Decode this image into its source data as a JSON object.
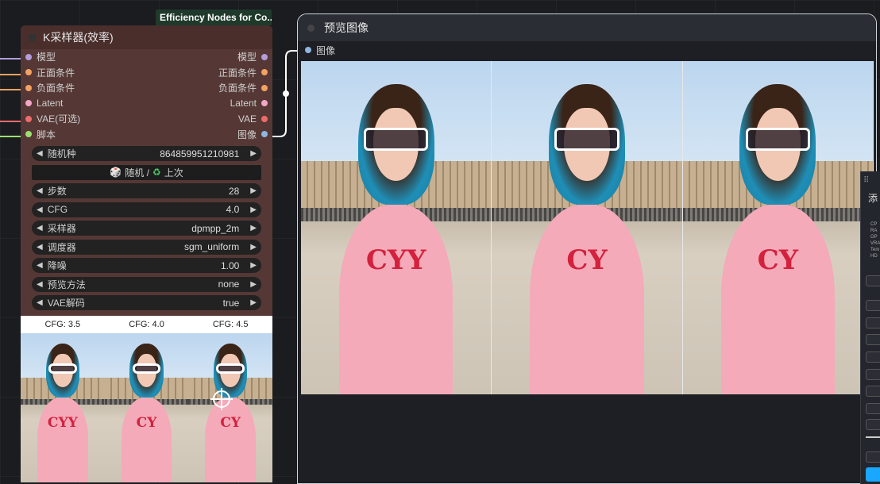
{
  "colors": {
    "canvas": "#1a1c20",
    "ksampler_body": "#553835",
    "ksampler_title": "#4a2e2c",
    "widget_bg": "#222222",
    "badge_bg": "#1f3a2b",
    "accent_blue": "#1aa7ff",
    "slot_model": "#b39ddb",
    "slot_positive": "#f4a261",
    "slot_negative": "#f4a261",
    "slot_latent": "#f3a6c8",
    "slot_vae": "#ef6b6b",
    "slot_script": "#9be070",
    "slot_image": "#8fb6e0"
  },
  "badge": {
    "text": "Efficiency Nodes for Co..."
  },
  "ksampler": {
    "title": "K采样器(效率)",
    "slots": [
      {
        "in": "模型",
        "out": "模型",
        "color": "#b39ddb"
      },
      {
        "in": "正面条件",
        "out": "正面条件",
        "color": "#f4a261"
      },
      {
        "in": "负面条件",
        "out": "负面条件",
        "color": "#f4a261"
      },
      {
        "in": "Latent",
        "out": "Latent",
        "color": "#f3a6c8"
      },
      {
        "in": "VAE(可选)",
        "out": "VAE",
        "color": "#ef6b6b"
      },
      {
        "in": "脚本",
        "out": "图像",
        "in_color": "#9be070",
        "color": "#8fb6e0"
      }
    ],
    "widgets": {
      "seed": {
        "label": "随机种",
        "value": "864859951210981"
      },
      "seed_button": {
        "random": "随机 /",
        "last": "上次"
      },
      "steps": {
        "label": "步数",
        "value": "28"
      },
      "cfg": {
        "label": "CFG",
        "value": "4.0"
      },
      "sampler": {
        "label": "采样器",
        "value": "dpmpp_2m"
      },
      "scheduler": {
        "label": "调度器",
        "value": "sgm_uniform"
      },
      "denoise": {
        "label": "降噪",
        "value": "1.00"
      },
      "preview_method": {
        "label": "预览方法",
        "value": "none"
      },
      "vae_decode": {
        "label": "VAE解码",
        "value": "true"
      }
    },
    "preview": {
      "cfg_labels": [
        "CFG: 3.5",
        "CFG: 4.0",
        "CFG: 4.5"
      ],
      "dress_texts": [
        "CYY",
        "CY",
        "CY"
      ]
    }
  },
  "preview_node": {
    "title": "预览图像",
    "slot_label": "图像",
    "dress_texts": [
      "CYY",
      "CY",
      "CY"
    ]
  },
  "side_panel": {
    "glyph": "添",
    "stats": [
      "CP",
      "RA",
      "GP",
      "VRA",
      "Tem",
      "HD"
    ]
  },
  "icons": {
    "arrow_left": "◀",
    "arrow_right": "▶",
    "dice": "🎲",
    "recycle": "♻"
  }
}
